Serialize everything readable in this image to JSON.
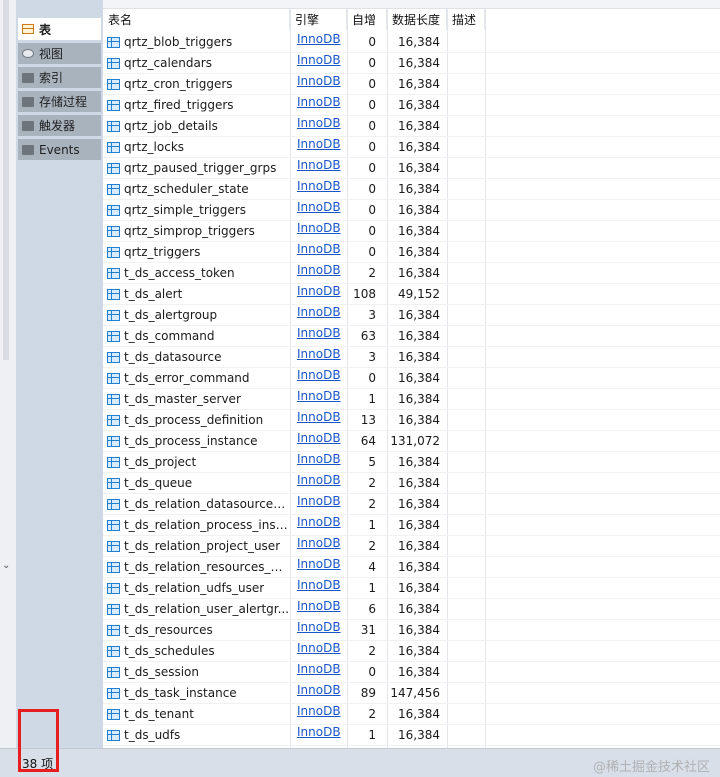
{
  "object_types": [
    {
      "label": "表",
      "icon": "table-icon",
      "active": true
    },
    {
      "label": "视图",
      "icon": "view-icon",
      "active": false
    },
    {
      "label": "索引",
      "icon": "folder-icon",
      "active": false
    },
    {
      "label": "存储过程",
      "icon": "folder-icon",
      "active": false
    },
    {
      "label": "触发器",
      "icon": "folder-icon",
      "active": false
    },
    {
      "label": "Events",
      "icon": "folder-icon",
      "active": false
    }
  ],
  "columns": {
    "name": "表名",
    "engine": "引擎",
    "auto_increment": "自增",
    "data_length": "数据长度",
    "comment": "描述"
  },
  "rows": [
    {
      "name": "qrtz_blob_triggers",
      "engine": "InnoDB",
      "auto": "0",
      "len": "16,384"
    },
    {
      "name": "qrtz_calendars",
      "engine": "InnoDB",
      "auto": "0",
      "len": "16,384"
    },
    {
      "name": "qrtz_cron_triggers",
      "engine": "InnoDB",
      "auto": "0",
      "len": "16,384"
    },
    {
      "name": "qrtz_fired_triggers",
      "engine": "InnoDB",
      "auto": "0",
      "len": "16,384"
    },
    {
      "name": "qrtz_job_details",
      "engine": "InnoDB",
      "auto": "0",
      "len": "16,384"
    },
    {
      "name": "qrtz_locks",
      "engine": "InnoDB",
      "auto": "0",
      "len": "16,384"
    },
    {
      "name": "qrtz_paused_trigger_grps",
      "engine": "InnoDB",
      "auto": "0",
      "len": "16,384"
    },
    {
      "name": "qrtz_scheduler_state",
      "engine": "InnoDB",
      "auto": "0",
      "len": "16,384"
    },
    {
      "name": "qrtz_simple_triggers",
      "engine": "InnoDB",
      "auto": "0",
      "len": "16,384"
    },
    {
      "name": "qrtz_simprop_triggers",
      "engine": "InnoDB",
      "auto": "0",
      "len": "16,384"
    },
    {
      "name": "qrtz_triggers",
      "engine": "InnoDB",
      "auto": "0",
      "len": "16,384"
    },
    {
      "name": "t_ds_access_token",
      "engine": "InnoDB",
      "auto": "2",
      "len": "16,384"
    },
    {
      "name": "t_ds_alert",
      "engine": "InnoDB",
      "auto": "108",
      "len": "49,152"
    },
    {
      "name": "t_ds_alertgroup",
      "engine": "InnoDB",
      "auto": "3",
      "len": "16,384"
    },
    {
      "name": "t_ds_command",
      "engine": "InnoDB",
      "auto": "63",
      "len": "16,384"
    },
    {
      "name": "t_ds_datasource",
      "engine": "InnoDB",
      "auto": "3",
      "len": "16,384"
    },
    {
      "name": "t_ds_error_command",
      "engine": "InnoDB",
      "auto": "0",
      "len": "16,384"
    },
    {
      "name": "t_ds_master_server",
      "engine": "InnoDB",
      "auto": "1",
      "len": "16,384"
    },
    {
      "name": "t_ds_process_definition",
      "engine": "InnoDB",
      "auto": "13",
      "len": "16,384"
    },
    {
      "name": "t_ds_process_instance",
      "engine": "InnoDB",
      "auto": "64",
      "len": "131,072"
    },
    {
      "name": "t_ds_project",
      "engine": "InnoDB",
      "auto": "5",
      "len": "16,384"
    },
    {
      "name": "t_ds_queue",
      "engine": "InnoDB",
      "auto": "2",
      "len": "16,384"
    },
    {
      "name": "t_ds_relation_datasource_...",
      "engine": "InnoDB",
      "auto": "2",
      "len": "16,384"
    },
    {
      "name": "t_ds_relation_process_inst...",
      "engine": "InnoDB",
      "auto": "1",
      "len": "16,384"
    },
    {
      "name": "t_ds_relation_project_user",
      "engine": "InnoDB",
      "auto": "2",
      "len": "16,384"
    },
    {
      "name": "t_ds_relation_resources_us...",
      "engine": "InnoDB",
      "auto": "4",
      "len": "16,384"
    },
    {
      "name": "t_ds_relation_udfs_user",
      "engine": "InnoDB",
      "auto": "1",
      "len": "16,384"
    },
    {
      "name": "t_ds_relation_user_alertgr...",
      "engine": "InnoDB",
      "auto": "6",
      "len": "16,384"
    },
    {
      "name": "t_ds_resources",
      "engine": "InnoDB",
      "auto": "31",
      "len": "16,384"
    },
    {
      "name": "t_ds_schedules",
      "engine": "InnoDB",
      "auto": "2",
      "len": "16,384"
    },
    {
      "name": "t_ds_session",
      "engine": "InnoDB",
      "auto": "0",
      "len": "16,384"
    },
    {
      "name": "t_ds_task_instance",
      "engine": "InnoDB",
      "auto": "89",
      "len": "147,456"
    },
    {
      "name": "t_ds_tenant",
      "engine": "InnoDB",
      "auto": "2",
      "len": "16,384"
    },
    {
      "name": "t_ds_udfs",
      "engine": "InnoDB",
      "auto": "1",
      "len": "16,384"
    }
  ],
  "status": {
    "count_text": "38 项"
  },
  "watermark": "@稀土掘金技术社区",
  "colors": {
    "link": "#1a56c9",
    "highlight": "#e61e1e",
    "panel": "#cfd9e6"
  }
}
